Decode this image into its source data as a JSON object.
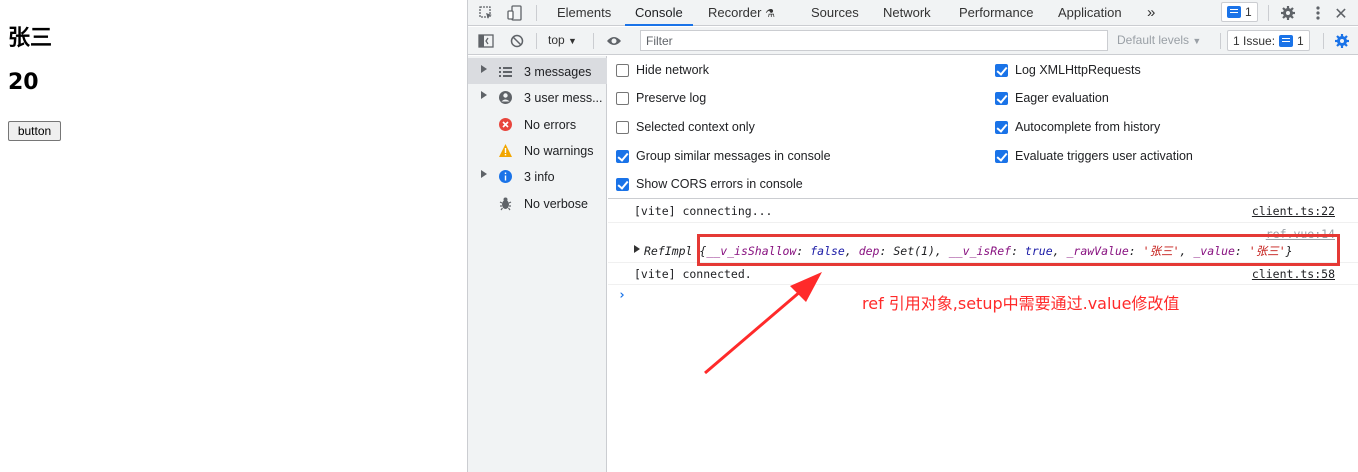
{
  "page": {
    "name": "张三",
    "age": "20",
    "button_label": "button"
  },
  "devtools": {
    "tabs": [
      "Elements",
      "Console",
      "Recorder",
      "Sources",
      "Network",
      "Performance",
      "Application"
    ],
    "active_tab": "Console",
    "more_tabs": "»",
    "issues_count": "1",
    "toolbar": {
      "context": "top",
      "filter_placeholder": "Filter",
      "levels": "Default levels",
      "issues_label": "1 Issue:",
      "issues_count": "1"
    },
    "sidebar": [
      {
        "label": "3 messages",
        "icon": "list-icon",
        "expandable": true
      },
      {
        "label": "3 user mess...",
        "icon": "user-icon",
        "expandable": true
      },
      {
        "label": "No errors",
        "icon": "error-icon",
        "expandable": false
      },
      {
        "label": "No warnings",
        "icon": "warning-icon",
        "expandable": false
      },
      {
        "label": "3 info",
        "icon": "info-icon",
        "expandable": true
      },
      {
        "label": "No verbose",
        "icon": "bug-icon",
        "expandable": false
      }
    ],
    "settings": {
      "left": [
        {
          "label": "Hide network",
          "checked": false
        },
        {
          "label": "Preserve log",
          "checked": false
        },
        {
          "label": "Selected context only",
          "checked": false
        },
        {
          "label": "Group similar messages in console",
          "checked": true
        },
        {
          "label": "Show CORS errors in console",
          "checked": true
        }
      ],
      "right": [
        {
          "label": "Log XMLHttpRequests",
          "checked": true
        },
        {
          "label": "Eager evaluation",
          "checked": true
        },
        {
          "label": "Autocomplete from history",
          "checked": true
        },
        {
          "label": "Evaluate triggers user activation",
          "checked": true
        }
      ]
    },
    "console": {
      "messages": [
        {
          "text": "[vite] connecting...",
          "source": "client.ts:22"
        },
        {
          "text": "RefImpl",
          "source": "ref.vue:14"
        },
        {
          "text": "[vite] connected.",
          "source": "client.ts:58"
        }
      ],
      "object_preview": {
        "open": "{",
        "k1": "__v_isShallow",
        "v1": "false",
        "k2": "dep",
        "v2": "Set(1)",
        "k3": "__v_isRef",
        "v3": "true",
        "k4": "_rawValue",
        "v4": "'张三'",
        "k5": "_value",
        "v5": "'张三'",
        "close": "}"
      },
      "prompt": "›"
    }
  },
  "annotation": {
    "text": "ref  引用对象,setup中需要通过.value修改值",
    "color": "#ff2a2a"
  },
  "colors": {
    "accent": "#1a73e8",
    "highlight": "#e53935"
  }
}
